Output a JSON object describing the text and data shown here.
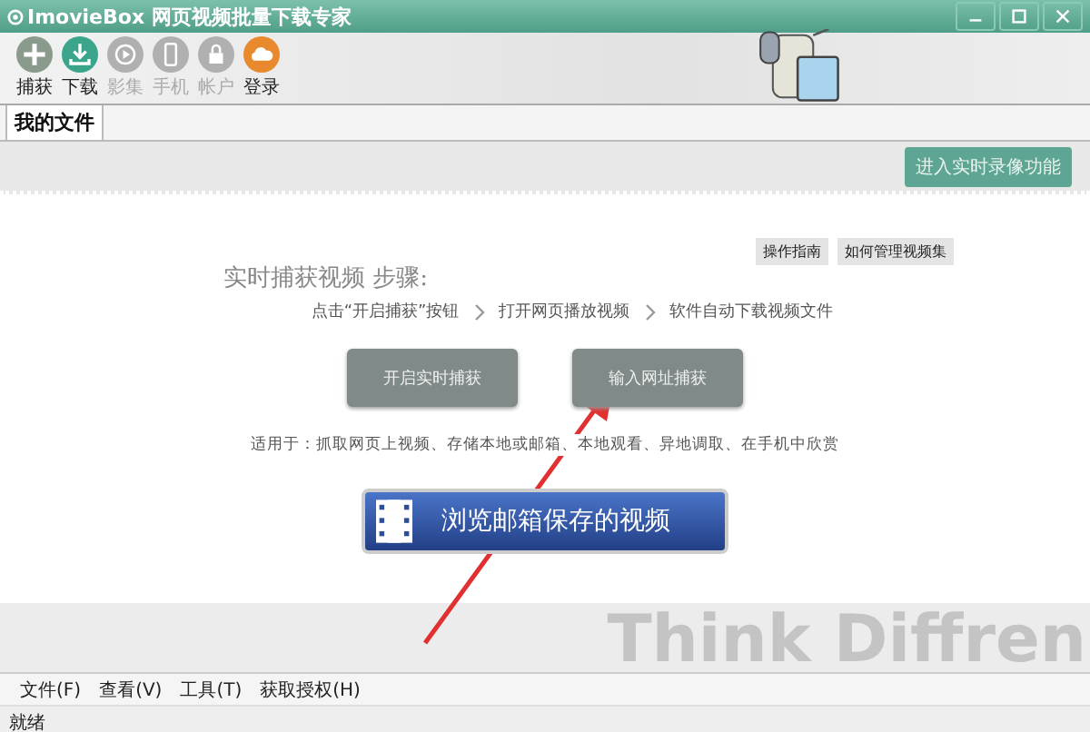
{
  "window": {
    "title": "ImovieBox 网页视频批量下载专家"
  },
  "toolbar": [
    {
      "kind": "plus",
      "label": "捕获",
      "color": "#8a9a8c",
      "disabled": false
    },
    {
      "kind": "download",
      "label": "下载",
      "color": "#3aa58a",
      "disabled": false
    },
    {
      "kind": "play",
      "label": "影集",
      "color": "#b0b0b0",
      "disabled": true
    },
    {
      "kind": "phone",
      "label": "手机",
      "color": "#b0b0b0",
      "disabled": true
    },
    {
      "kind": "lock",
      "label": "帐户",
      "color": "#b0b0b0",
      "disabled": true
    },
    {
      "kind": "cloud",
      "label": "登录",
      "color": "#e8892e",
      "disabled": false
    }
  ],
  "tabs": [
    {
      "label": "我的文件",
      "selected": true
    }
  ],
  "live_record_button": "进入实时录像功能",
  "help_buttons": [
    "操作指南",
    "如何管理视频集"
  ],
  "steps_title": "实时捕获视频 步骤:",
  "steps": [
    "点击“开启捕获”按钮",
    "打开网页播放视频",
    "软件自动下载视频文件"
  ],
  "actions": [
    "开启实时捕获",
    "输入网址捕获"
  ],
  "usage": "适用于：抓取网页上视频、存储本地或邮箱、本地观看、异地调取、在手机中欣赏",
  "mailbox_button": "浏览邮箱保存的视频",
  "banner_text": "Think Diffren",
  "menu": [
    "文件(F)",
    "查看(V)",
    "工具(T)",
    "获取授权(H)"
  ],
  "status_bar": "就绪"
}
